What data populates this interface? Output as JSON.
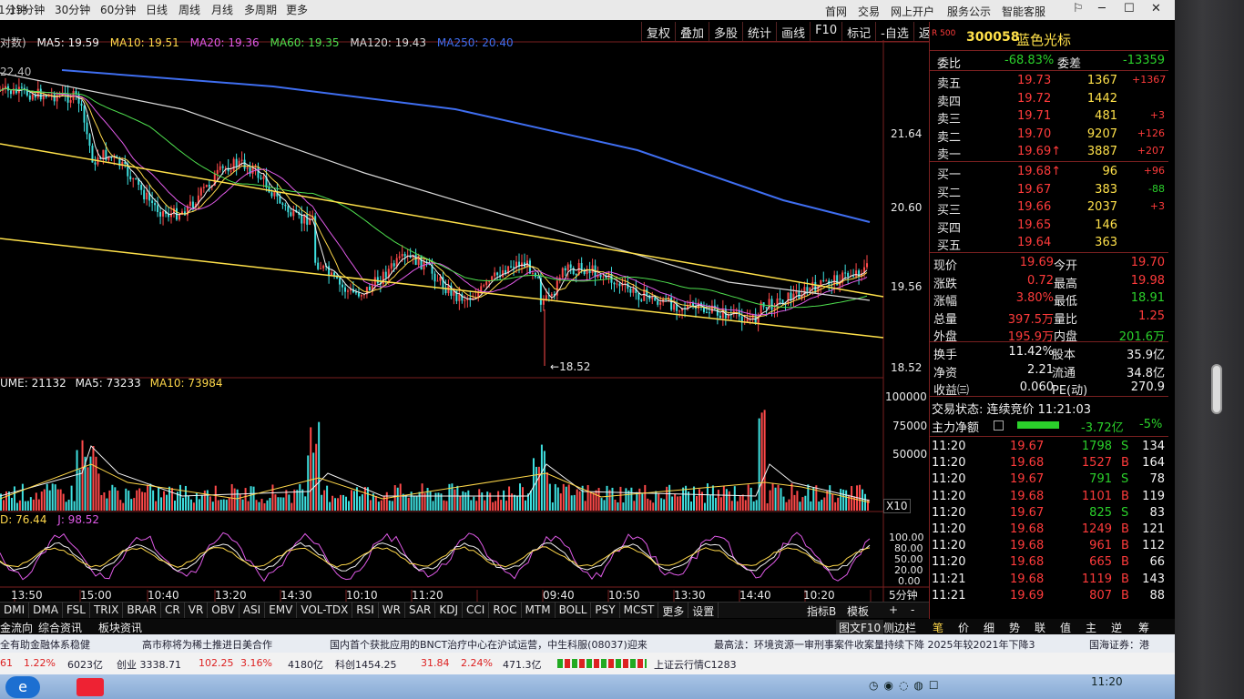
{
  "top_bar": {
    "periods": [
      "1分钟",
      "15分钟",
      "30分钟",
      "60分钟",
      "日线",
      "周线",
      "月线",
      "多周期",
      "更多"
    ],
    "right_menu": [
      "首网",
      "交易",
      "网上开户",
      "服务公示",
      "智能客服"
    ]
  },
  "ma_bar": {
    "ma5": "MA5: 19.59",
    "ma10": "MA10: 19.51",
    "ma20": "MA20: 19.36",
    "ma60": "MA60: 19.35",
    "ma120": "MA120: 19.43",
    "ma250": "MA250: 20.40"
  },
  "toolbar_buttons": [
    "复权",
    "叠加",
    "多股",
    "统计",
    "画线",
    "F10",
    "标记",
    "-自选",
    "返回"
  ],
  "price_axis": [
    "22.40",
    "21.64",
    "20.60",
    "19.56",
    "18.52"
  ],
  "low_marker": "18.52",
  "volume_bar": {
    "label": "UME: 21132",
    "ma5": "MA5: 73233",
    "ma10": "MA10: 73984",
    "axis": [
      "100000",
      "75000",
      "50000"
    ],
    "unit": "X10"
  },
  "kdj_bar": {
    "d": "D: 76.44",
    "j": "J: 98.52",
    "axis": [
      "100.00",
      "80.00",
      "50.00",
      "20.00",
      "0.00"
    ]
  },
  "time_axis": [
    "13:50",
    "15:00",
    "10:40",
    "13:20",
    "14:30",
    "10:10",
    "11:20",
    "09:40",
    "10:50",
    "13:30",
    "14:40",
    "10:20"
  ],
  "indicator_bar": [
    "DMI",
    "DMA",
    "FSL",
    "TRIX",
    "BRAR",
    "CR",
    "VR",
    "OBV",
    "ASI",
    "EMV",
    "VOL-TDX",
    "RSI",
    "WR",
    "SAR",
    "KDJ",
    "CCI",
    "ROC",
    "MTM",
    "BOLL",
    "PSY",
    "MCST",
    "更多",
    "设置"
  ],
  "indicator_right": [
    "5分钟",
    "指标B",
    "模板",
    "+",
    "-"
  ],
  "stock": {
    "code": "300058",
    "name": "蓝色光标",
    "market_tag": "R 500"
  },
  "weibi": {
    "label": "委比",
    "value": "-68.83%",
    "label2": "委差",
    "value2": "-13359"
  },
  "sells": [
    {
      "label": "卖五",
      "price": "19.73",
      "vol": "1367",
      "chg": "+1367"
    },
    {
      "label": "卖四",
      "price": "19.72",
      "vol": "1442",
      "chg": ""
    },
    {
      "label": "卖三",
      "price": "19.71",
      "vol": "481",
      "chg": "+3"
    },
    {
      "label": "卖二",
      "price": "19.70",
      "vol": "9207",
      "chg": "+126"
    },
    {
      "label": "卖一",
      "price": "19.69↑",
      "vol": "3887",
      "chg": "+207"
    }
  ],
  "buys": [
    {
      "label": "买一",
      "price": "19.68↑",
      "vol": "96",
      "chg": "+96"
    },
    {
      "label": "买二",
      "price": "19.67",
      "vol": "383",
      "chg": "-88"
    },
    {
      "label": "买三",
      "price": "19.66",
      "vol": "2037",
      "chg": "+3"
    },
    {
      "label": "买四",
      "price": "19.65",
      "vol": "146",
      "chg": ""
    },
    {
      "label": "买五",
      "price": "19.64",
      "vol": "363",
      "chg": ""
    }
  ],
  "quote": [
    {
      "l1": "现价",
      "v1": "19.69",
      "l2": "今开",
      "v2": "19.70"
    },
    {
      "l1": "涨跌",
      "v1": "0.72",
      "l2": "最高",
      "v2": "19.98"
    },
    {
      "l1": "涨幅",
      "v1": "3.80%",
      "l2": "最低",
      "v2": "18.91"
    },
    {
      "l1": "总量",
      "v1": "397.5万",
      "l2": "量比",
      "v2": "1.25"
    },
    {
      "l1": "外盘",
      "v1": "195.9万",
      "l2": "内盘",
      "v2": "201.6万"
    }
  ],
  "fund": [
    {
      "l1": "换手",
      "v1": "11.42%",
      "l2": "股本",
      "v2": "35.9亿"
    },
    {
      "l1": "净资",
      "v1": "2.21",
      "l2": "流通",
      "v2": "34.8亿"
    },
    {
      "l1": "收益㈢",
      "v1": "0.060",
      "l2": "PE(动)",
      "v2": "270.9"
    }
  ],
  "trade_status": "交易状态: 连续竞价 11:21:03",
  "main_flow": {
    "label": "主力净额",
    "value": "-3.72亿",
    "pct": "-5%"
  },
  "ticks": [
    {
      "t": "11:20",
      "p": "19.67",
      "v": "1798",
      "s": "S",
      "n": "134"
    },
    {
      "t": "11:20",
      "p": "19.68",
      "v": "1527",
      "s": "B",
      "n": "164"
    },
    {
      "t": "11:20",
      "p": "19.67",
      "v": "791",
      "s": "S",
      "n": "78"
    },
    {
      "t": "11:20",
      "p": "19.68",
      "v": "1101",
      "s": "B",
      "n": "119"
    },
    {
      "t": "11:20",
      "p": "19.67",
      "v": "825",
      "s": "S",
      "n": "83"
    },
    {
      "t": "11:20",
      "p": "19.68",
      "v": "1249",
      "s": "B",
      "n": "121"
    },
    {
      "t": "11:20",
      "p": "19.68",
      "v": "961",
      "s": "B",
      "n": "112"
    },
    {
      "t": "11:20",
      "p": "19.68",
      "v": "665",
      "s": "B",
      "n": "66"
    },
    {
      "t": "11:21",
      "p": "19.68",
      "v": "1119",
      "s": "B",
      "n": "143"
    },
    {
      "t": "11:21",
      "p": "19.69",
      "v": "807",
      "s": "B",
      "n": "88"
    }
  ],
  "right_tabs": [
    "笔",
    "价",
    "细",
    "势",
    "联",
    "值",
    "主",
    "逆",
    "筹"
  ],
  "bottom_tabs": [
    "金流向",
    "综合资讯",
    "板块资讯",
    "图文F10",
    "侧边栏"
  ],
  "news": [
    "全有助金融体系稳健",
    "高市称将为稀土推进日美合作",
    "国内首个获批应用的BNCT治疗中心在沪试运营，中生科服(08037)迎来",
    "最高法：环境资源一审刑事案件收案量持续下降 2025年较2021年下降3",
    "国海证券：港"
  ],
  "index_bar": [
    "61",
    "1.22%",
    "6023亿",
    "创业 3338.71",
    "102.25",
    "3.16%",
    "4180亿",
    "科创1454.25",
    "31.84",
    "2.24%",
    "471.3亿",
    "上证云行情C1283"
  ],
  "clock": "11:20"
}
